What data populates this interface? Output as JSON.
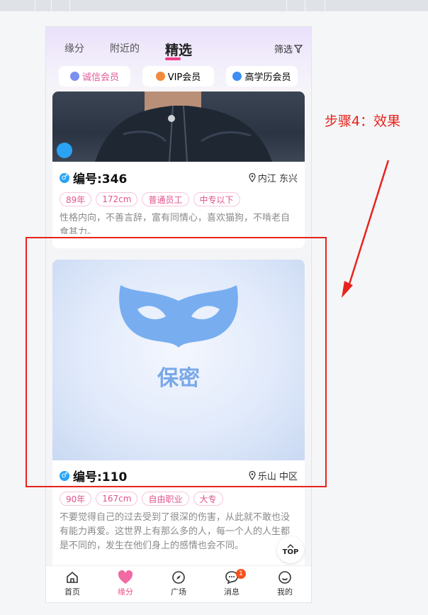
{
  "tabs": [
    "缘分",
    "附近的",
    "精选"
  ],
  "filter_label": "筛选",
  "chips": [
    {
      "label": "诚信会员",
      "color": "#e25b96",
      "icon": "medal-icon",
      "icon_color": "#7b8ff0"
    },
    {
      "label": "VIP会员",
      "color": "#333333",
      "icon": "diamond-icon",
      "icon_color": "#f08a3c"
    },
    {
      "label": "高学历会员",
      "color": "#333333",
      "icon": "gem-icon",
      "icon_color": "#3f8ef1"
    }
  ],
  "cards": [
    {
      "id": "编号:346",
      "location": "内江 东兴",
      "tags": [
        "89年",
        "172cm",
        "普通员工",
        "中专以下"
      ],
      "bio": "性格内向，不善言辞，富有同情心，喜欢猫狗，不啃老自食其力。"
    },
    {
      "id": "编号:110",
      "location": "乐山 中区",
      "secret_label": "保密",
      "tags": [
        "90年",
        "167cm",
        "自由职业",
        "大专"
      ],
      "bio": "不要觉得自己的过去受到了很深的伤害，从此就不敢也没有能力再爱。这世界上有那么多的人，每一个人的人生都是不同的，发生在他们身上的感情也会不同。"
    }
  ],
  "top_button": "TOP",
  "nav": [
    {
      "label": "首页",
      "icon": "home-icon"
    },
    {
      "label": "缘分",
      "icon": "heart-icon"
    },
    {
      "label": "广场",
      "icon": "compass-icon"
    },
    {
      "label": "消息",
      "icon": "chat-icon",
      "badge": "1"
    },
    {
      "label": "我的",
      "icon": "user-icon"
    }
  ],
  "annotation": "步骤4：效果",
  "colors": {
    "accent_pink": "#ee3e8b",
    "male_blue": "#2aa3f4",
    "annotation_red": "#e8231e"
  }
}
